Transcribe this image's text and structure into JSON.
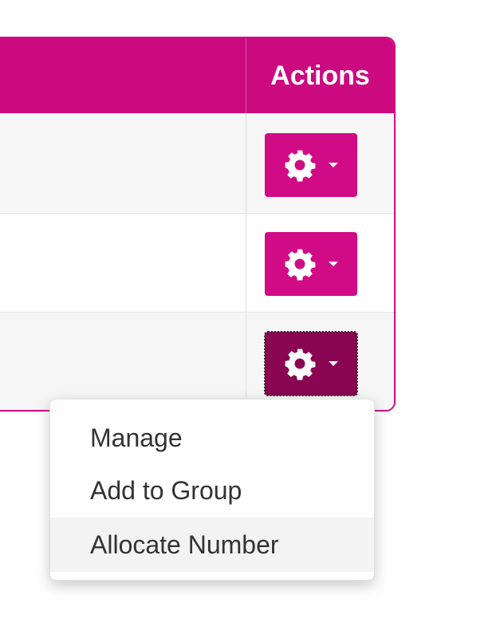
{
  "table": {
    "header": {
      "actions_label": "Actions"
    },
    "rows": [
      {
        "actions_button": "gear-icon",
        "state": "default"
      },
      {
        "actions_button": "gear-icon",
        "state": "default"
      },
      {
        "actions_button": "gear-icon",
        "state": "active"
      }
    ]
  },
  "dropdown": {
    "items": [
      {
        "label": "Manage"
      },
      {
        "label": "Add to Group"
      },
      {
        "label": "Allocate Number",
        "highlighted": true
      }
    ]
  },
  "colors": {
    "accent": "#cc0a80",
    "button": "#d00b85",
    "button_active": "#8a0652",
    "menu_highlight": "#f3f3f3"
  }
}
